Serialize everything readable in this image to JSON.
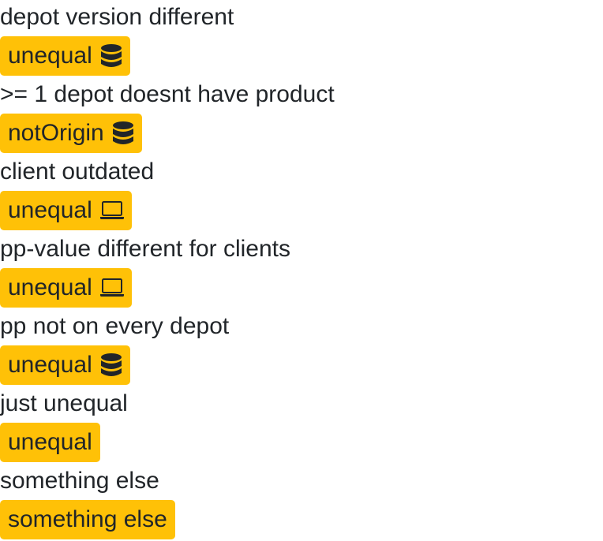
{
  "items": [
    {
      "caption": "depot version different",
      "badge": "unequal",
      "icon": "database-icon"
    },
    {
      "caption": ">= 1 depot doesnt have product",
      "badge": "notOrigin",
      "icon": "database-icon"
    },
    {
      "caption": "client outdated",
      "badge": "unequal",
      "icon": "laptop-icon"
    },
    {
      "caption": "pp-value different for clients",
      "badge": "unequal",
      "icon": "laptop-icon"
    },
    {
      "caption": "pp not on every depot",
      "badge": "unequal",
      "icon": "database-icon"
    },
    {
      "caption": "just unequal",
      "badge": "unequal",
      "icon": ""
    },
    {
      "caption": "something else",
      "badge": "something else",
      "icon": ""
    }
  ],
  "colors": {
    "badge_background": "#ffc107",
    "text": "#212529"
  }
}
